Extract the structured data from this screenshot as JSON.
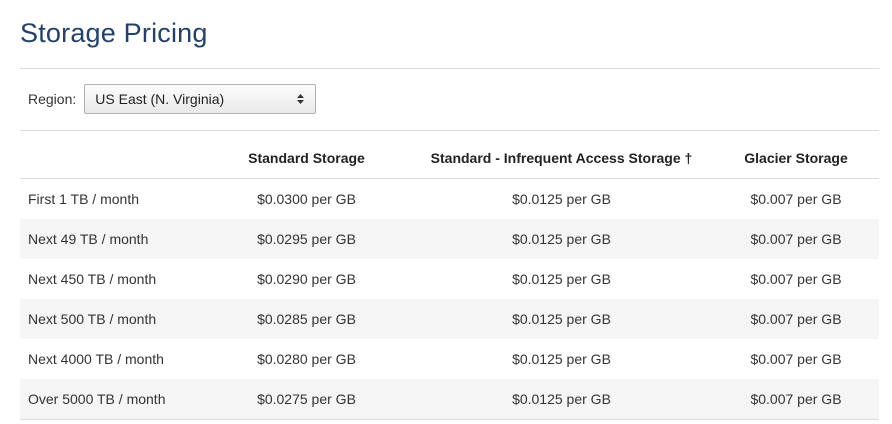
{
  "page": {
    "title": "Storage Pricing"
  },
  "region": {
    "label": "Region:",
    "selected": "US East (N. Virginia)"
  },
  "table": {
    "headers": [
      "",
      "Standard Storage",
      "Standard - Infrequent Access Storage †",
      "Glacier Storage"
    ],
    "rows": [
      {
        "tier": "First 1 TB / month",
        "standard": "$0.0300 per GB",
        "infrequent": "$0.0125 per GB",
        "glacier": "$0.007 per GB"
      },
      {
        "tier": "Next 49 TB / month",
        "standard": "$0.0295 per GB",
        "infrequent": "$0.0125 per GB",
        "glacier": "$0.007 per GB"
      },
      {
        "tier": "Next 450 TB / month",
        "standard": "$0.0290 per GB",
        "infrequent": "$0.0125 per GB",
        "glacier": "$0.007 per GB"
      },
      {
        "tier": "Next 500 TB / month",
        "standard": "$0.0285 per GB",
        "infrequent": "$0.0125 per GB",
        "glacier": "$0.007 per GB"
      },
      {
        "tier": "Next 4000 TB / month",
        "standard": "$0.0280 per GB",
        "infrequent": "$0.0125 per GB",
        "glacier": "$0.007 per GB"
      },
      {
        "tier": "Over 5000 TB / month",
        "standard": "$0.0275 per GB",
        "infrequent": "$0.0125 per GB",
        "glacier": "$0.007 per GB"
      }
    ]
  },
  "icons": {
    "select_arrows": "select-arrows-icon"
  },
  "colors": {
    "title": "#23416b",
    "row_alt": "#f5f5f5",
    "rule": "#dddddd"
  }
}
